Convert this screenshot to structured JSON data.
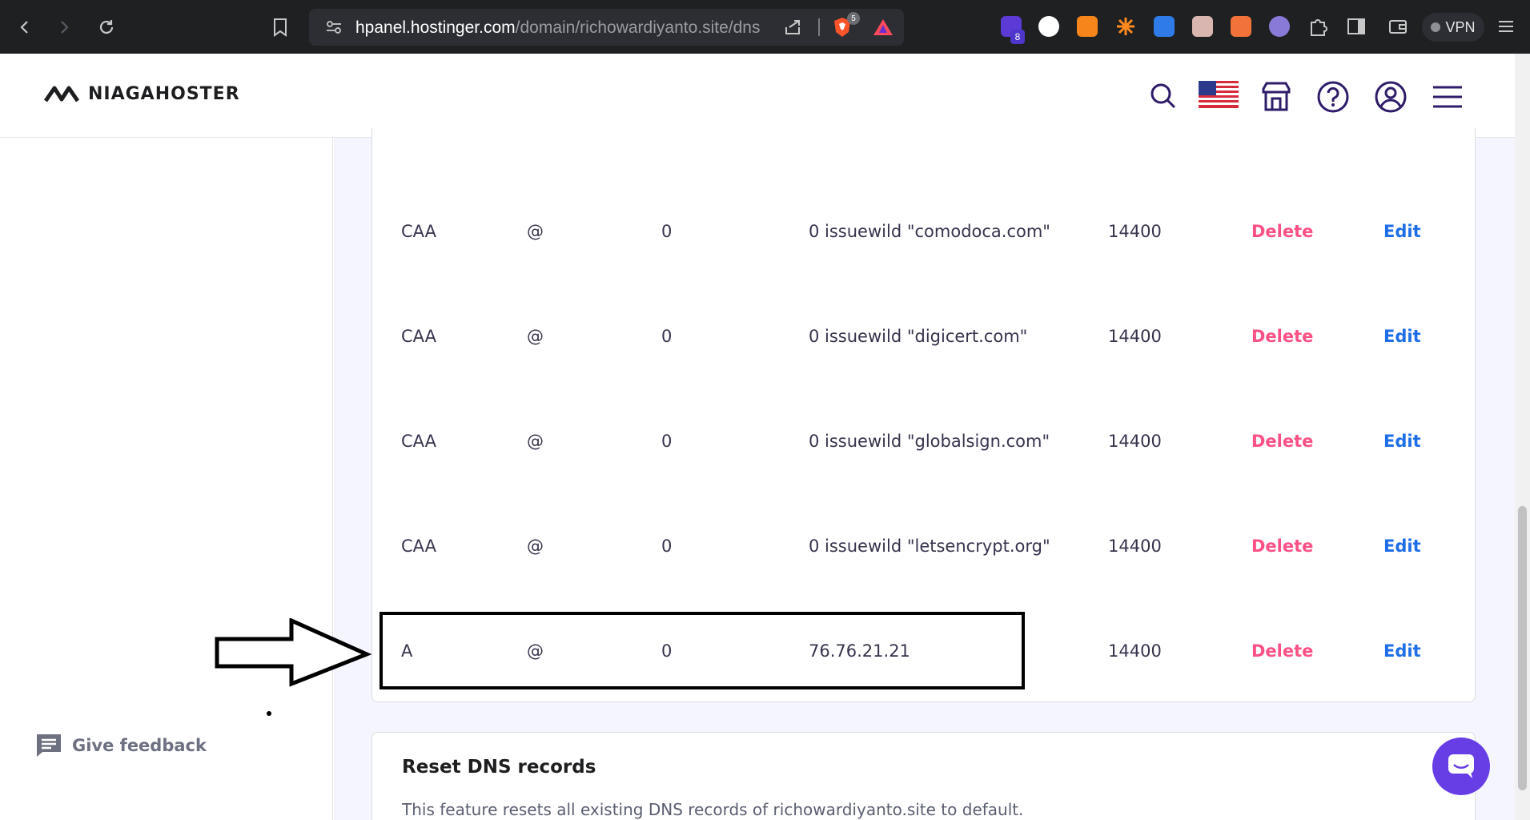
{
  "browser": {
    "url_host": "hpanel.hostinger.com",
    "url_path": "/domain/richowardiyanto.site/dns",
    "shield_badge": "5",
    "ext_badge": "8",
    "vpn_label": "VPN"
  },
  "header": {
    "logo_text": "NIAGAHOSTER"
  },
  "dns_records": [
    {
      "type": "CAA",
      "name": "@",
      "priority": "0",
      "content": "0 issuewild \"comodoca.com\"",
      "ttl": "14400",
      "delete_label": "Delete",
      "edit_label": "Edit"
    },
    {
      "type": "CAA",
      "name": "@",
      "priority": "0",
      "content": "0 issuewild \"digicert.com\"",
      "ttl": "14400",
      "delete_label": "Delete",
      "edit_label": "Edit"
    },
    {
      "type": "CAA",
      "name": "@",
      "priority": "0",
      "content": "0 issuewild \"globalsign.com\"",
      "ttl": "14400",
      "delete_label": "Delete",
      "edit_label": "Edit"
    },
    {
      "type": "CAA",
      "name": "@",
      "priority": "0",
      "content": "0 issuewild \"letsencrypt.org\"",
      "ttl": "14400",
      "delete_label": "Delete",
      "edit_label": "Edit"
    },
    {
      "type": "A",
      "name": "@",
      "priority": "0",
      "content": "76.76.21.21",
      "ttl": "14400",
      "delete_label": "Delete",
      "edit_label": "Edit"
    }
  ],
  "reset": {
    "title": "Reset DNS records",
    "description": "This feature resets all existing DNS records of richowardiyanto.site to default."
  },
  "feedback": {
    "label": "Give feedback"
  },
  "icons": {
    "back": "back-arrow-icon",
    "forward": "forward-arrow-icon",
    "reload": "reload-icon",
    "bookmark": "bookmark-icon",
    "share": "share-icon",
    "search": "search-icon",
    "flag": "us-flag-icon",
    "store": "store-icon",
    "help": "help-icon",
    "account": "account-icon",
    "menu": "menu-icon",
    "chat": "chat-icon"
  },
  "colors": {
    "delete": "#fc5185",
    "edit": "#1d6ee8",
    "chat": "#673de6"
  }
}
